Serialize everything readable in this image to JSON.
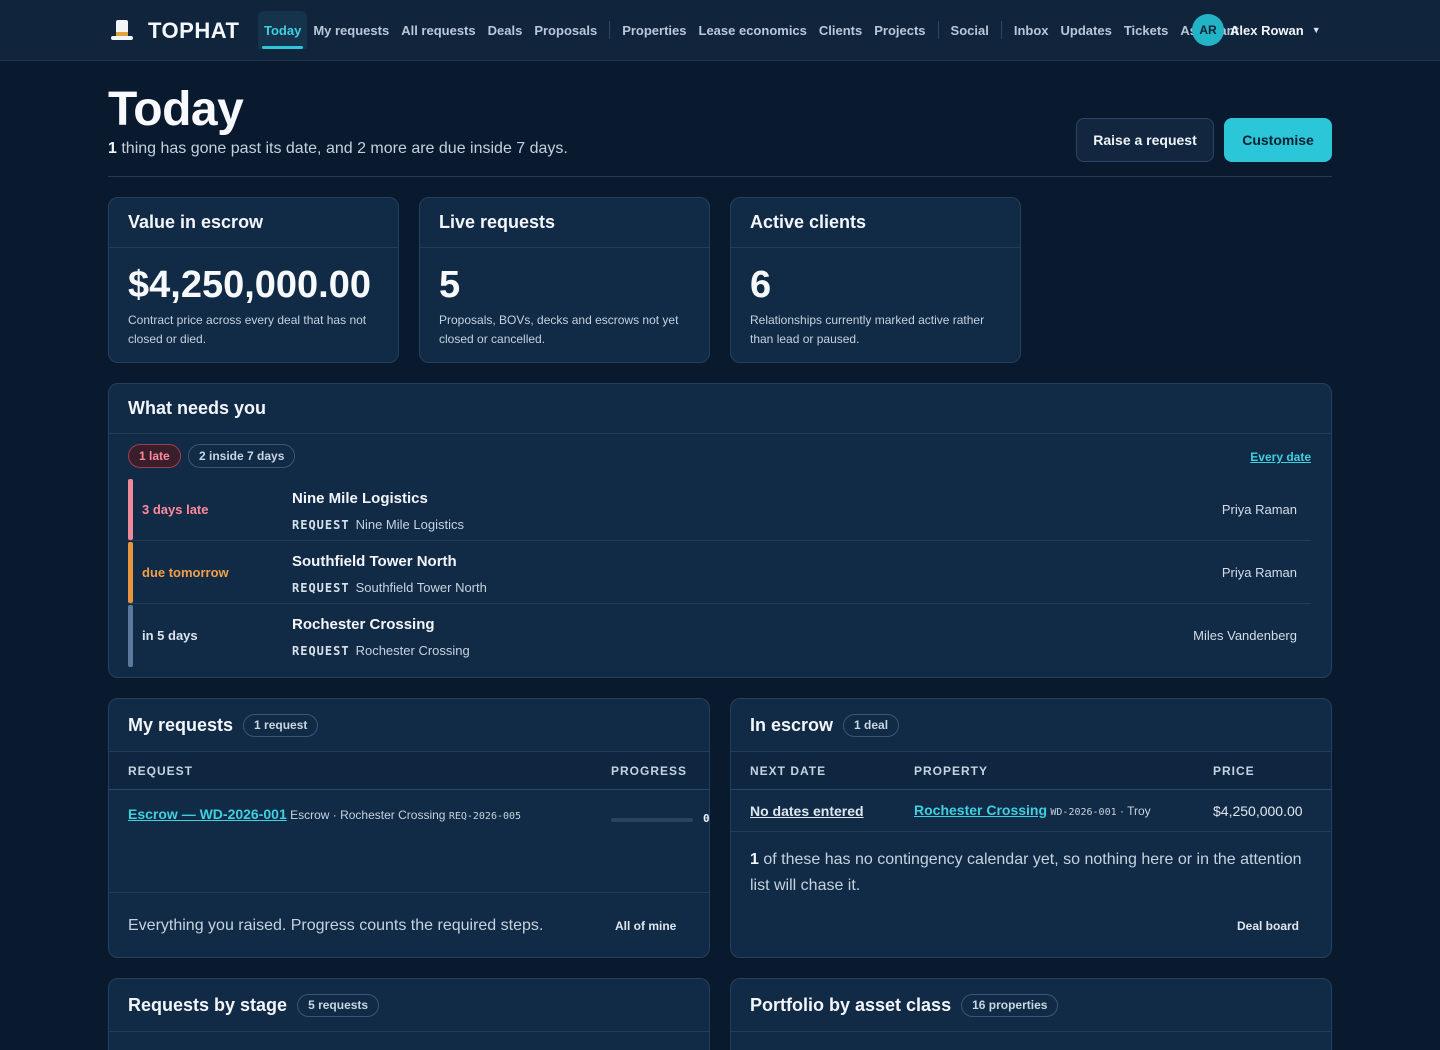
{
  "brand": {
    "name": "TOPHAT"
  },
  "nav": {
    "items": [
      {
        "label": "Today",
        "active": true
      },
      {
        "label": "My requests"
      },
      {
        "label": "All requests"
      },
      {
        "label": "Deals"
      },
      {
        "label": "Proposals"
      },
      {
        "label": "Properties"
      },
      {
        "label": "Lease economics"
      },
      {
        "label": "Clients"
      },
      {
        "label": "Projects"
      },
      {
        "label": "Social"
      },
      {
        "label": "Inbox"
      },
      {
        "label": "Updates"
      },
      {
        "label": "Tickets"
      },
      {
        "label": "Assistant"
      }
    ],
    "user": {
      "initials": "AR",
      "name": "Alex Rowan"
    }
  },
  "header": {
    "title": "Today",
    "late_count": "1",
    "subtitle_rest": " thing has gone past its date, and 2 more are due inside 7 days.",
    "raise_label": "Raise a request",
    "customise_label": "Customise"
  },
  "stats": [
    {
      "title": "Value in escrow",
      "value": "$4,250,000.00",
      "desc": "Contract price across every deal that has not closed or died."
    },
    {
      "title": "Live requests",
      "value": "5",
      "desc": "Proposals, BOVs, decks and escrows not yet closed or cancelled."
    },
    {
      "title": "Active clients",
      "value": "6",
      "desc": "Relationships currently marked active rather than lead or paused."
    }
  ],
  "attention": {
    "title": "What needs you",
    "late_pill": "1 late",
    "soon_pill": "2 inside 7 days",
    "every_date": "Every date",
    "rows": [
      {
        "when": "3 days late",
        "name": "Nine Mile Logistics",
        "kind": "REQUEST",
        "ref": "Nine Mile Logistics",
        "owner": "Priya Raman",
        "color": "#f08a9a",
        "when_color": "#ff8a9b"
      },
      {
        "when": "due tomorrow",
        "name": "Southfield Tower North",
        "kind": "REQUEST",
        "ref": "Southfield Tower North",
        "owner": "Priya Raman",
        "color": "#e8953e",
        "when_color": "#f0a048"
      },
      {
        "when": "in 5 days",
        "name": "Rochester Crossing",
        "kind": "REQUEST",
        "ref": "Rochester Crossing",
        "owner": "Miles Vandenberg",
        "color": "#5b7a9e",
        "when_color": "#dbe4ee"
      }
    ]
  },
  "my_requests": {
    "title": "My requests",
    "chip": "1 request",
    "col_request": "REQUEST",
    "col_progress": "PROGRESS",
    "row": {
      "link": "Escrow — WD-2026-001",
      "meta": "Escrow · Rochester Crossing",
      "code": "REQ-2026-005",
      "progress": 0,
      "progress_label": "0"
    },
    "footer": "Everything you raised. Progress counts the required steps.",
    "footer_link": "All of mine"
  },
  "escrow": {
    "title": "In escrow",
    "chip": "1 deal",
    "col_next": "NEXT DATE",
    "col_property": "PROPERTY",
    "col_price": "PRICE",
    "row": {
      "next": "No dates entered",
      "property": "Rochester Crossing",
      "code": "WD-2026-001",
      "city": " · Troy",
      "price": "$4,250,000.00"
    },
    "note_count": "1",
    "note_rest": " of these has no contingency calendar yet, so nothing here or in the attention list will chase it.",
    "footer_link": "Deal board"
  },
  "stage": {
    "title": "Requests by stage",
    "chip": "5 requests"
  },
  "portfolio": {
    "title": "Portfolio by asset class",
    "chip": "16 properties"
  }
}
